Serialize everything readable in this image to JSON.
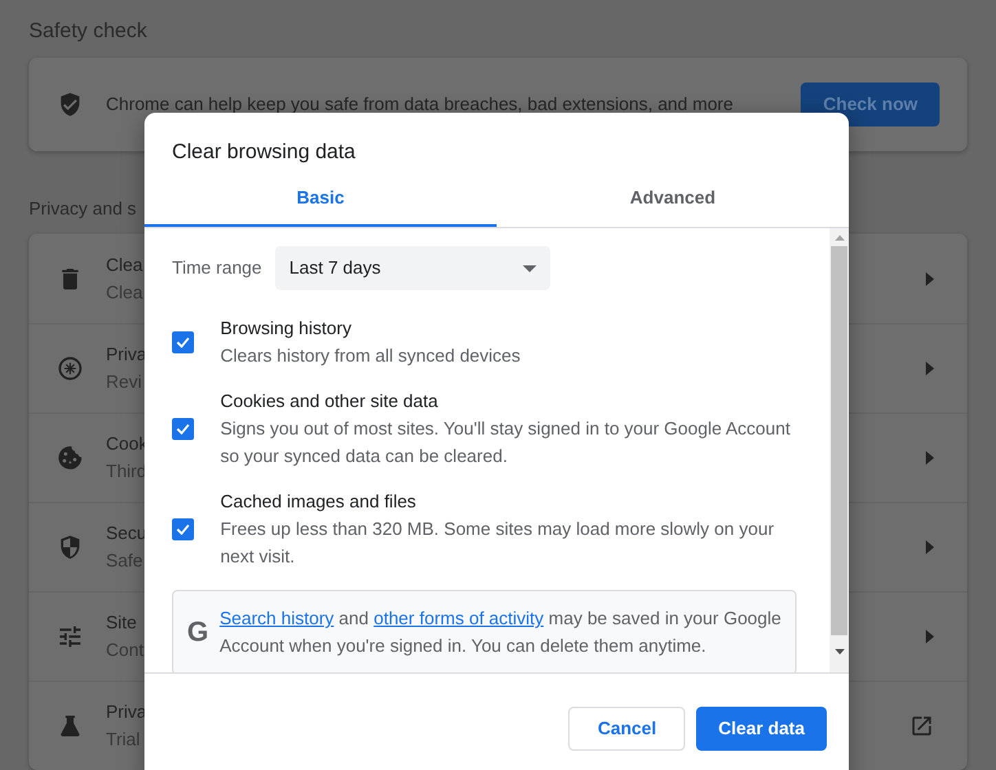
{
  "page": {
    "safety_heading": "Safety check",
    "safety_text": "Chrome can help keep you safe from data breaches, bad extensions, and more",
    "check_button": "Check now",
    "privacy_heading": "Privacy and s",
    "rows": [
      {
        "kind": "trash",
        "title": "Clea",
        "subtitle": "Clea",
        "opens_externally": false
      },
      {
        "kind": "compass",
        "title": "Priva",
        "subtitle": "Revi",
        "opens_externally": false
      },
      {
        "kind": "cookie",
        "title": "Cook",
        "subtitle": "Third",
        "opens_externally": false
      },
      {
        "kind": "shield",
        "title": "Secu",
        "subtitle": "Safe",
        "opens_externally": false
      },
      {
        "kind": "sliders",
        "title": "Site",
        "subtitle": "Cont",
        "opens_externally": false
      },
      {
        "kind": "flask",
        "title": "Priva",
        "subtitle": "Trial",
        "opens_externally": true
      }
    ]
  },
  "dialog": {
    "title": "Clear browsing data",
    "tabs": [
      {
        "label": "Basic",
        "selected": true
      },
      {
        "label": "Advanced",
        "selected": false
      }
    ],
    "time_range": {
      "label": "Time range",
      "value": "Last 7 days"
    },
    "options": [
      {
        "title": "Browsing history",
        "description": "Clears history from all synced devices",
        "checked": true
      },
      {
        "title": "Cookies and other site data",
        "description": "Signs you out of most sites. You'll stay signed in to your Google Account so your synced data can be cleared.",
        "checked": true
      },
      {
        "title": "Cached images and files",
        "description": "Frees up less than 320 MB. Some sites may load more slowly on your next visit.",
        "checked": true
      }
    ],
    "notice": {
      "icon_letter": "G",
      "link_1": "Search history",
      "text_1": "and",
      "link_2": "other forms of activity",
      "text_2": "may be saved in your Google Account when you're signed in. You can delete them anytime."
    },
    "buttons": [
      {
        "label": "Cancel",
        "kind": "secondary"
      },
      {
        "label": "Clear data",
        "kind": "primary"
      }
    ]
  }
}
